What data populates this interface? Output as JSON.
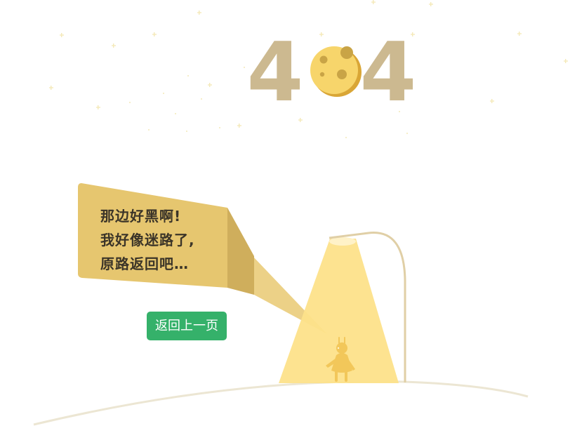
{
  "page": {
    "code_left_digit": "4",
    "code_right_digit": "4"
  },
  "bubble": {
    "lines": [
      "那边好黑啊!",
      "我好像迷路了,",
      "原路返回吧…"
    ]
  },
  "back_button": {
    "label": "返回上一页"
  },
  "colors": {
    "digit": "#ccb990",
    "moon": "#f7d56b",
    "moon_shadow": "#d9a636",
    "moon_crater": "#c9a446",
    "bubble": "#e6c66f",
    "bubble_dark": "#cfae5c",
    "light_beam": "#fde18a",
    "lamp_post": "#e0cfa6",
    "button": "#35b16a",
    "button_text": "#ffffff",
    "text": "#3b3428",
    "star": "#f4e9b8",
    "ground_line": "#ece6d3"
  },
  "icons": {
    "moon": "moon-icon",
    "street_lamp": "street-lamp-icon",
    "rabbit_figure": "rabbit-figure-icon",
    "stars": "star-icon"
  }
}
